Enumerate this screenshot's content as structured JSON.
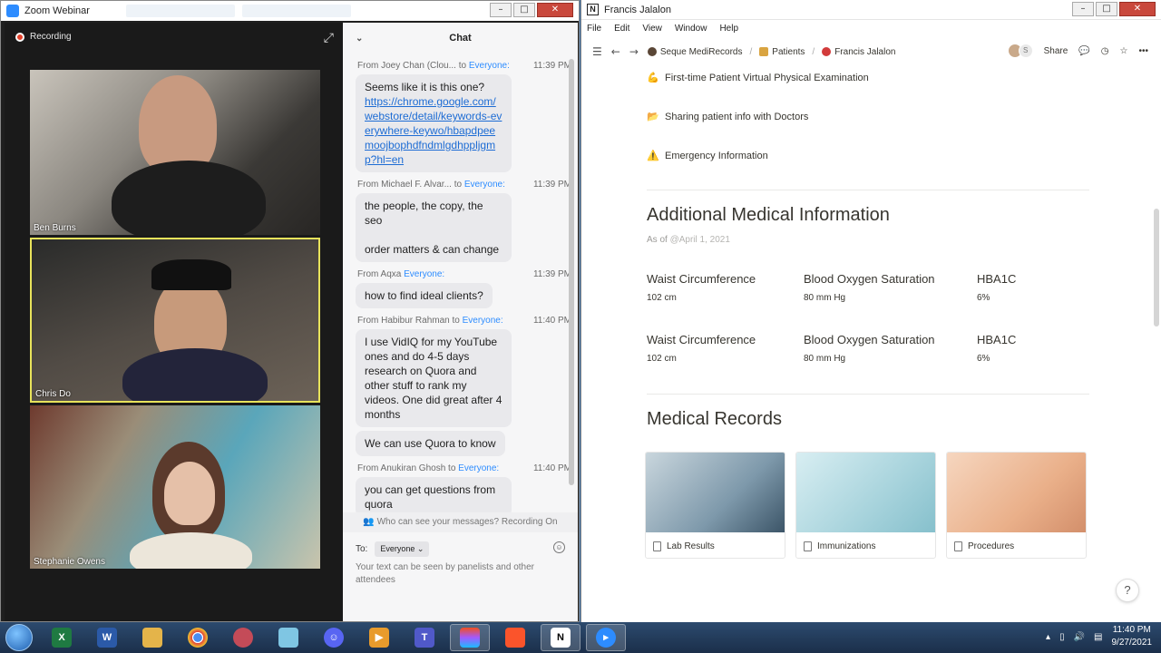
{
  "zoom": {
    "window_title": "Zoom Webinar",
    "recording_label": "Recording",
    "participants": [
      {
        "name": "Ben Burns"
      },
      {
        "name": "Chris Do"
      },
      {
        "name": "Stephanie Owens"
      }
    ],
    "chat": {
      "title": "Chat",
      "messages": [
        {
          "from": "From Joey Chan (Clou...",
          "to": "Everyone:",
          "time": "11:39 PM",
          "lines": [
            "Seems like it is this one?"
          ],
          "link": "https://chrome.google.com/webstore/detail/keywords-everywhere-keywo/hbapdpeemoojbophdfndmlgdhppljgmp?hl=en"
        },
        {
          "from": "From Michael F. Alvar...",
          "to": "Everyone:",
          "time": "11:39 PM",
          "lines": [
            "the people, the copy, the seo",
            "order matters & can change"
          ]
        },
        {
          "from": "From Aqxa",
          "to": "Everyone:",
          "time": "11:39 PM",
          "lines": [
            "how to find ideal clients?"
          ]
        },
        {
          "from": "From Habibur Rahman",
          "to": "Everyone:",
          "time": "11:40 PM",
          "lines": [
            "I use VidIQ for my YouTube ones and do 4-5 days research on Quora and other stuff to rank my videos. One did great after 4 months",
            "We can use Quora to know"
          ]
        },
        {
          "from": "From Anukiran Ghosh",
          "to": "Everyone:",
          "time": "11:40 PM",
          "lines": [
            "you can get questions from quora"
          ]
        }
      ],
      "to_word": "to",
      "who_can_see": "Who can see your messages? Recording On",
      "to_label": "To:",
      "to_value": "Everyone",
      "hint": "Your text can be seen by panelists and other attendees"
    }
  },
  "notion": {
    "window_title": "Francis Jalalon",
    "menu": [
      "File",
      "Edit",
      "View",
      "Window",
      "Help"
    ],
    "breadcrumb": [
      "Seque MediRecords",
      "Patients",
      "Francis Jalalon"
    ],
    "share_label": "Share",
    "avatar_letter": "S",
    "links": [
      {
        "emoji": "💪",
        "text": "First-time Patient Virtual Physical Examination"
      },
      {
        "emoji": "📂",
        "text": "Sharing patient info with Doctors"
      },
      {
        "emoji": "⚠️",
        "text": "Emergency Information"
      }
    ],
    "section1_title": "Additional Medical Information",
    "as_of_label": "As of",
    "as_of_date": "@April 1, 2021",
    "metrics": [
      {
        "label": "Waist Circumference",
        "value": "102 cm"
      },
      {
        "label": "Blood Oxygen Saturation",
        "value": "80 mm Hg"
      },
      {
        "label": "HBA1C",
        "value": "6%"
      },
      {
        "label": "Waist Circumference",
        "value": "102 cm"
      },
      {
        "label": "Blood Oxygen Saturation",
        "value": "80 mm Hg"
      },
      {
        "label": "HBA1C",
        "value": "6%"
      }
    ],
    "section2_title": "Medical Records",
    "cards": [
      {
        "title": "Lab Results",
        "color": "#8aa7b8"
      },
      {
        "title": "Immunizations",
        "color": "#a9cfd8"
      },
      {
        "title": "Procedures",
        "color": "#e7b08a"
      }
    ],
    "help": "?"
  },
  "taskbar": {
    "apps": [
      "excel",
      "word",
      "explorer",
      "chrome",
      "snipping-tool",
      "notepad",
      "discord",
      "media-player",
      "teams",
      "figma",
      "brave",
      "notion",
      "zoom"
    ],
    "time": "11:40 PM",
    "date": "9/27/2021"
  }
}
